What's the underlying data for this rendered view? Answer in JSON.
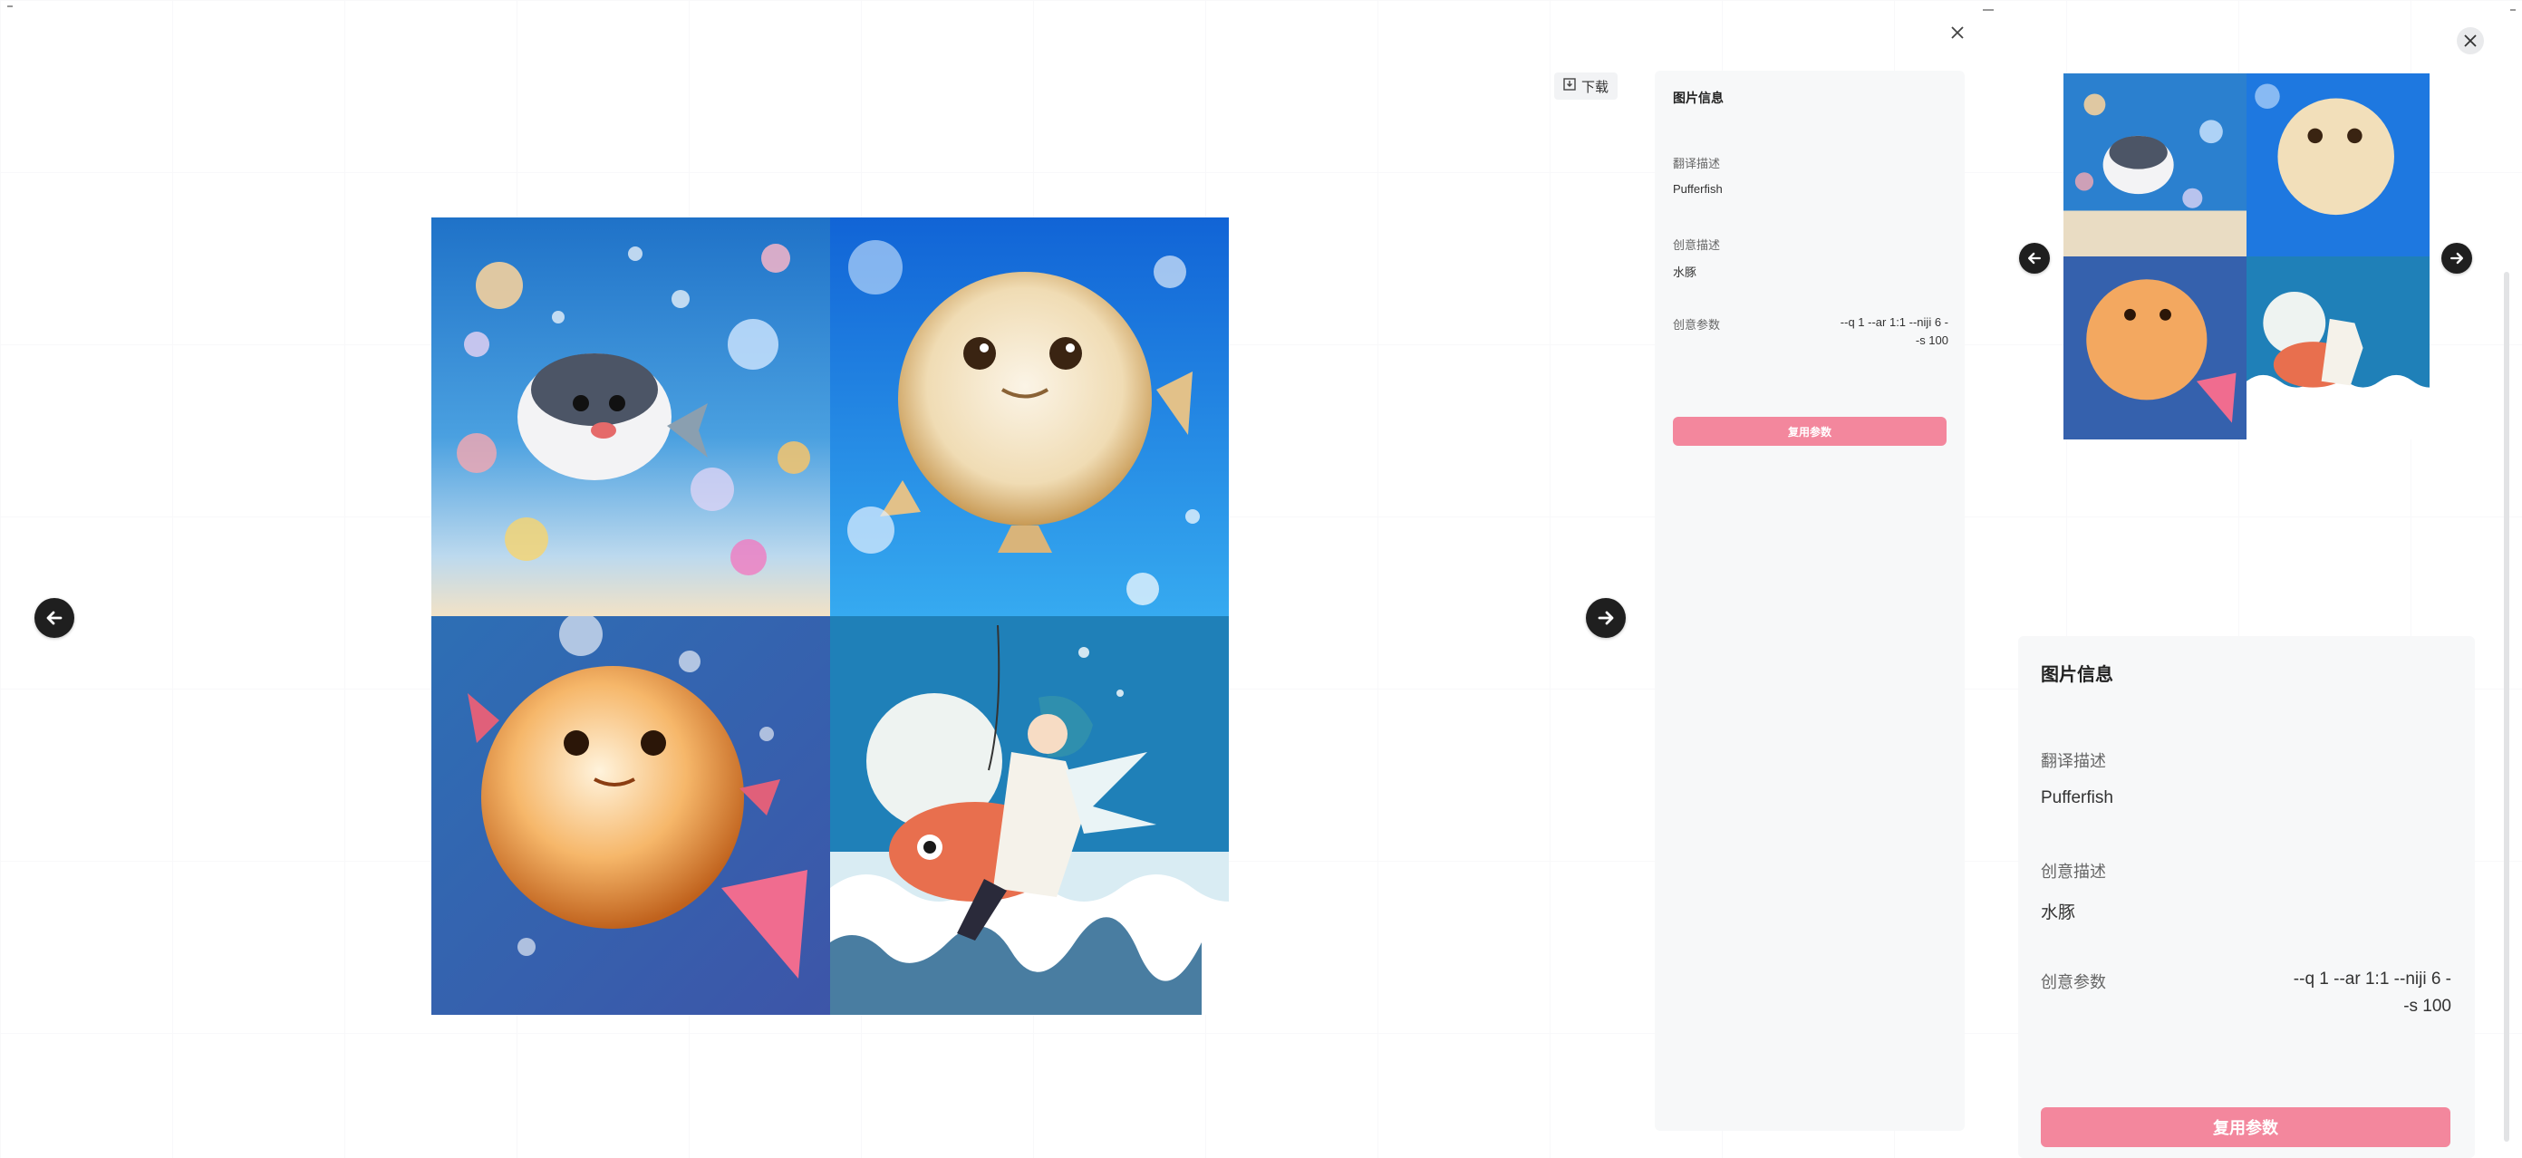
{
  "toolbar": {
    "download_label": "下载"
  },
  "info": {
    "title": "图片信息",
    "translate_label": "翻译描述",
    "translate_value": "Pufferfish",
    "creative_label": "创意描述",
    "creative_value": "水豚",
    "params_label": "创意参数",
    "params_value_line1": "--q 1 --ar 1:1 --niji 6 -",
    "params_value_line2": "-s 100",
    "apply_button": "复用参数"
  },
  "icons": {
    "prev": "arrow-left-icon",
    "next": "arrow-right-icon",
    "close": "close-icon",
    "download": "download-icon"
  },
  "colors": {
    "accent": "#f3879d",
    "nav": "#1f1f1f",
    "panel_bg": "#f7f8f9"
  }
}
